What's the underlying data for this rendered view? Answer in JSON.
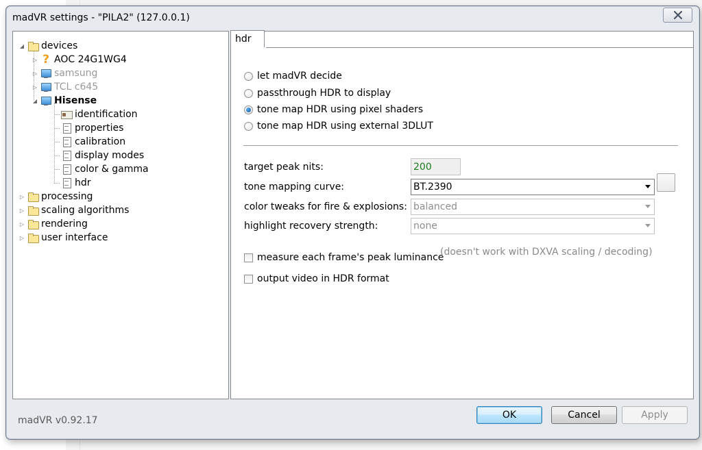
{
  "window": {
    "title": "madVR settings - \"PILA2\" (127.0.0.1)"
  },
  "icons": {
    "close": "close-icon"
  },
  "tree": {
    "root": {
      "label": "devices"
    },
    "devices": [
      {
        "label": "AOC 24G1WG4",
        "icon": "question-icon",
        "state": "normal"
      },
      {
        "label": "samsung",
        "icon": "monitor-icon",
        "state": "disabled"
      },
      {
        "label": "TCL c645",
        "icon": "monitor-icon",
        "state": "disabled"
      },
      {
        "label": "Hisense",
        "icon": "monitor-icon",
        "state": "selected-bold"
      }
    ],
    "hisense_children": [
      {
        "label": "identification",
        "icon": "id-card-icon"
      },
      {
        "label": "properties",
        "icon": "page-icon"
      },
      {
        "label": "calibration",
        "icon": "page-icon"
      },
      {
        "label": "display modes",
        "icon": "page-icon"
      },
      {
        "label": "color & gamma",
        "icon": "page-icon"
      },
      {
        "label": "hdr",
        "icon": "page-icon"
      }
    ],
    "other_roots": [
      {
        "label": "processing"
      },
      {
        "label": "scaling algorithms"
      },
      {
        "label": "rendering"
      },
      {
        "label": "user interface"
      }
    ]
  },
  "tab": {
    "label": "hdr"
  },
  "hdr_mode": {
    "options": [
      {
        "label": "let madVR decide",
        "checked": false
      },
      {
        "label": "passthrough HDR to display",
        "checked": false
      },
      {
        "label": "tone map HDR using pixel shaders",
        "checked": true
      },
      {
        "label": "tone map HDR using external 3DLUT",
        "checked": false
      }
    ]
  },
  "settings": {
    "target_peak_nits_label": "target peak nits:",
    "target_peak_nits_value": "200",
    "tone_mapping_curve_label": "tone mapping curve:",
    "tone_mapping_curve_value": "BT.2390",
    "color_tweaks_label": "color tweaks for fire & explosions:",
    "color_tweaks_value": "balanced",
    "highlight_recovery_label": "highlight recovery strength:",
    "highlight_recovery_value": "none"
  },
  "options": {
    "measure_peak_label": "measure each frame's peak luminance",
    "measure_peak_checked": false,
    "measure_peak_hint": "(doesn't work with DXVA scaling / decoding)",
    "output_hdr_label": "output video in HDR format",
    "output_hdr_checked": false
  },
  "footer": {
    "version": "madVR v0.92.17",
    "ok_label": "OK",
    "cancel_label": "Cancel",
    "apply_label": "Apply"
  }
}
